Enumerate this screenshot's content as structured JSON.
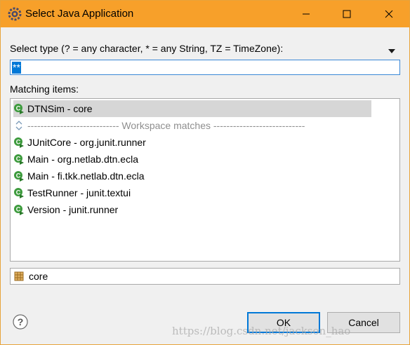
{
  "window": {
    "title": "Select Java Application",
    "accent_color": "#f7a02a",
    "app_icon": "eclipse-gear-icon",
    "controls": [
      "minimize-icon",
      "maximize-icon",
      "close-icon"
    ]
  },
  "filter": {
    "label": "Select type (? = any character, * = any String, TZ = TimeZone):",
    "value": "**",
    "menu_icon": "chevron-down-icon"
  },
  "matching": {
    "label": "Matching items:",
    "items": [
      {
        "text": "DTNSim - core",
        "icon": "java-class-run-icon",
        "selected": true
      },
      {
        "text": "---------------------------- Workspace matches ----------------------------",
        "icon": "expand-collapse-icon",
        "separator": true
      },
      {
        "text": "JUnitCore - org.junit.runner",
        "icon": "java-class-run-icon"
      },
      {
        "text": "Main - org.netlab.dtn.ecla",
        "icon": "java-class-run-icon"
      },
      {
        "text": "Main - fi.tkk.netlab.dtn.ecla",
        "icon": "java-class-run-icon"
      },
      {
        "text": "TestRunner - junit.textui",
        "icon": "java-class-run-icon"
      },
      {
        "text": "Version - junit.runner",
        "icon": "java-class-run-icon"
      }
    ]
  },
  "details": {
    "text": "core",
    "icon": "package-icon"
  },
  "footer": {
    "help_icon": "help-icon",
    "ok_label": "OK",
    "cancel_label": "Cancel"
  },
  "watermark": "https://blog.csdn.net/jackson_hao"
}
